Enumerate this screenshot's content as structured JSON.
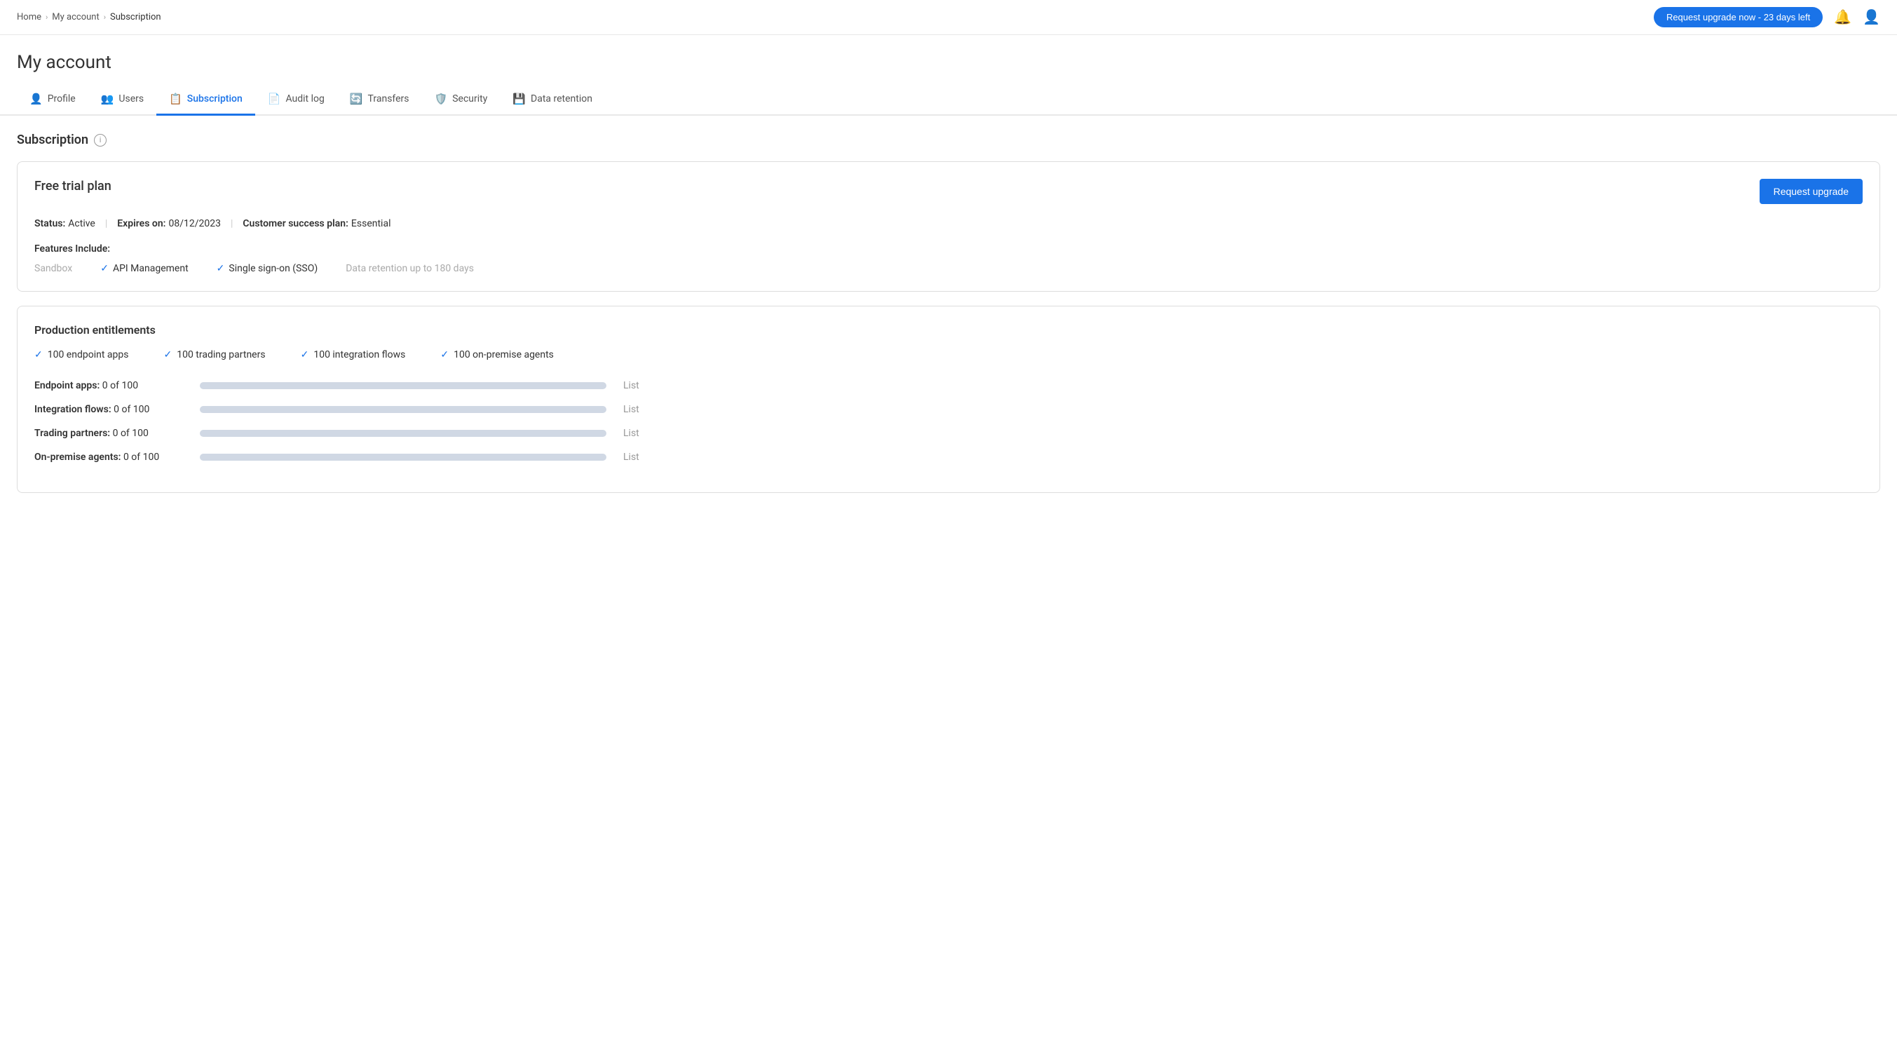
{
  "breadcrumb": {
    "home": "Home",
    "myaccount": "My account",
    "current": "Subscription"
  },
  "topbar": {
    "upgrade_btn": "Request upgrade now - 23 days left",
    "bell_icon": "🔔",
    "user_icon": "👤"
  },
  "page": {
    "title": "My account"
  },
  "tabs": [
    {
      "id": "profile",
      "label": "Profile",
      "icon": "👤",
      "active": false
    },
    {
      "id": "users",
      "label": "Users",
      "icon": "👥",
      "active": false
    },
    {
      "id": "subscription",
      "label": "Subscription",
      "icon": "📋",
      "active": true
    },
    {
      "id": "auditlog",
      "label": "Audit log",
      "icon": "📄",
      "active": false
    },
    {
      "id": "transfers",
      "label": "Transfers",
      "icon": "🔄",
      "active": false
    },
    {
      "id": "security",
      "label": "Security",
      "icon": "🛡️",
      "active": false
    },
    {
      "id": "dataretention",
      "label": "Data retention",
      "icon": "💾",
      "active": false
    }
  ],
  "subscription": {
    "section_title": "Subscription",
    "plan_title": "Free trial plan",
    "request_upgrade_btn": "Request upgrade",
    "status_label": "Status:",
    "status_value": "Active",
    "expires_label": "Expires on:",
    "expires_value": "08/12/2023",
    "customer_success_label": "Customer success plan:",
    "customer_success_value": "Essential",
    "features_label": "Features Include:",
    "features": [
      {
        "label": "Sandbox",
        "enabled": false
      },
      {
        "label": "API Management",
        "enabled": true
      },
      {
        "label": "Single sign-on (SSO)",
        "enabled": true
      },
      {
        "label": "Data retention up to 180 days",
        "enabled": false
      }
    ]
  },
  "entitlements": {
    "title": "Production entitlements",
    "items": [
      {
        "label": "100 endpoint apps"
      },
      {
        "label": "100 trading partners"
      },
      {
        "label": "100 integration flows"
      },
      {
        "label": "100 on-premise agents"
      }
    ],
    "usage": [
      {
        "label": "Endpoint apps:",
        "used": 0,
        "total": 100
      },
      {
        "label": "Integration flows:",
        "used": 0,
        "total": 100
      },
      {
        "label": "Trading partners:",
        "used": 0,
        "total": 100
      },
      {
        "label": "On-premise agents:",
        "used": 0,
        "total": 100
      }
    ],
    "list_link": "List"
  }
}
